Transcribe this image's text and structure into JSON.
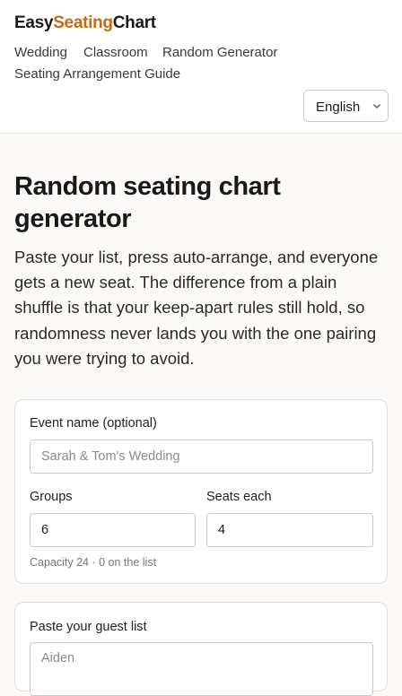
{
  "brand": {
    "part1": "Easy",
    "part2": "Seating",
    "part3": "Chart",
    "accent_color": "#c46b11"
  },
  "nav": {
    "items": [
      {
        "label": "Wedding"
      },
      {
        "label": "Classroom"
      },
      {
        "label": "Random Generator"
      },
      {
        "label": "Seating Arrangement Guide"
      }
    ]
  },
  "language": {
    "selected": "English",
    "icon": "chevron-down-icon"
  },
  "main": {
    "title": "Random seating chart generator",
    "intro": "Paste your list, press auto-arrange, and everyone gets a new seat. The difference from a plain shuffle is that your keep-apart rules still hold, so randomness never lands you with the one pairing you were trying to avoid."
  },
  "event_form": {
    "event_name_label": "Event name (optional)",
    "event_name_placeholder": "Sarah & Tom's Wedding",
    "groups_label": "Groups",
    "groups_value": "6",
    "seats_label": "Seats each",
    "seats_value": "4",
    "capacity_text": "Capacity 24 · 0 on the list"
  },
  "guest_form": {
    "label": "Paste your guest list",
    "placeholder": "Aiden"
  }
}
